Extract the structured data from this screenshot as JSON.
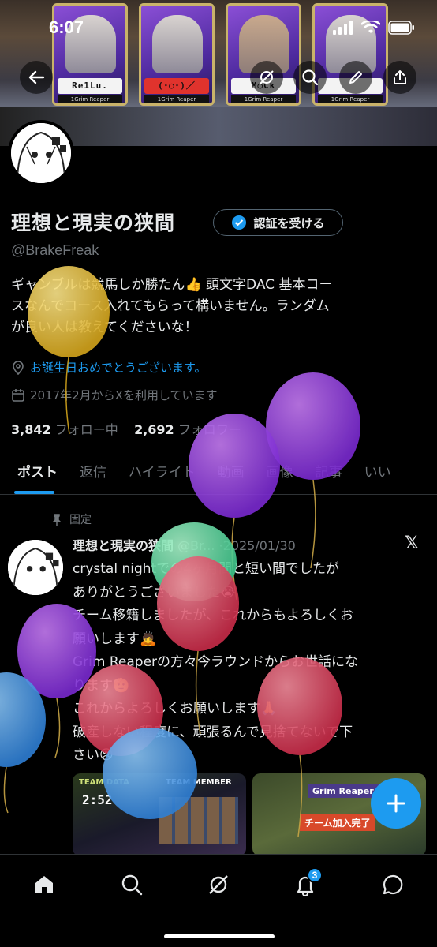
{
  "status_bar": {
    "time": "6:07"
  },
  "header_cards": [
    {
      "name": "Re1Lu.",
      "sub": "1Grim Reaper"
    },
    {
      "name": "(･○･)／",
      "sub": "1Grim Reaper"
    },
    {
      "name": "M○Ck",
      "sub": "1Grim Reaper"
    },
    {
      "name": "",
      "sub": "1Grim Reaper"
    }
  ],
  "profile": {
    "name": "理想と現実の狭間",
    "handle": "@BrakeFreak",
    "verify_label": "認証を受ける",
    "bio_lines": [
      "ギャンブルは競馬しか勝たん👍 頭文字DAC 基本コー",
      "スなんでコース入れてもらって構いません。ランダム",
      "が良い人は教えてくださいな！"
    ],
    "birthday": "お誕生日おめでとうございます。",
    "joined": "2017年2月からXを利用しています",
    "following_count": "3,842",
    "following_label": "フォロー中",
    "followers_count": "2,692",
    "followers_label": "フォロワー"
  },
  "tabs": [
    "ポスト",
    "返信",
    "ハイライト",
    "動画",
    "画像",
    "記事",
    "いい"
  ],
  "pinned_post": {
    "pinned_label": "固定",
    "author": "理想と現実の狭間",
    "handle": "@Br...",
    "date": "·2025/01/30",
    "lines": [
      "crystal nightでの4ヶ月間と短い間でしたが",
      "ありがとうございました😭",
      "チーム移籍しましたが、これからもよろしくお",
      "願いします🙇",
      "Grim Reaperの方々今ラウンドからお世話にな",
      "ります🫡",
      "これからよろしくお願いします🙏",
      "破産しない程度に、頑張るんで見捨てないで下",
      "さい😢"
    ],
    "media_left": {
      "label": "TEAM DATA",
      "value": "2:52",
      "member_label": "TEAM MEMBER"
    },
    "media_right": {
      "label": "Grim Reaper",
      "caption": "チーム加入完了"
    }
  },
  "bottom_nav": {
    "notification_count": "3"
  },
  "colors": {
    "accent": "#1d9bf0",
    "background": "#000000",
    "muted": "#71767b",
    "text": "#e7e9ea"
  }
}
